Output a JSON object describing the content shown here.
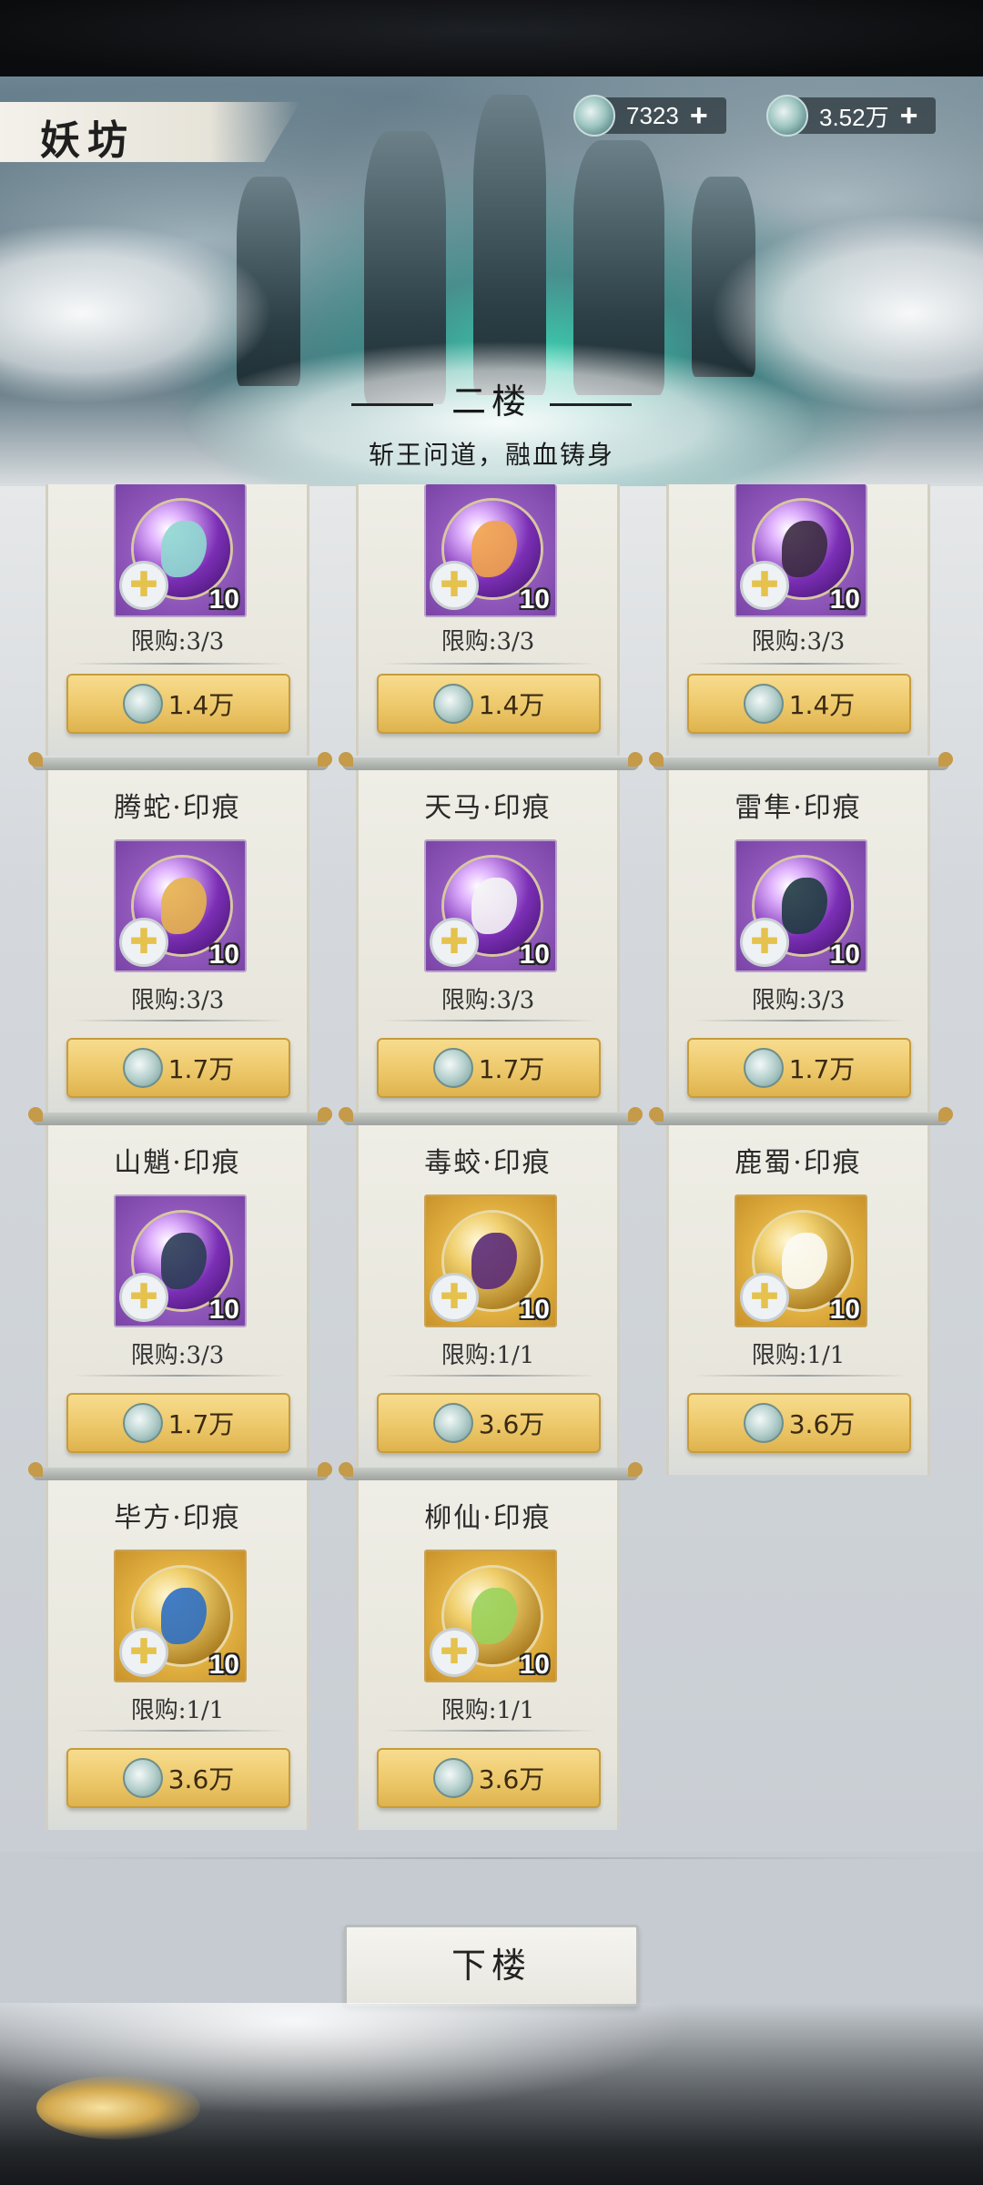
{
  "header": {
    "title": "妖坊",
    "currency1": {
      "icon": "jade-ring-icon",
      "amount": "7323"
    },
    "currency2": {
      "icon": "jade-pendant-icon",
      "amount": "3.52万"
    },
    "plus": "+"
  },
  "floor": {
    "name": "二楼",
    "subtitle": "斩王问道，融血铸身"
  },
  "items": [
    {
      "name": "",
      "tier": "purple",
      "qty": "10",
      "limit": "限购:3/3",
      "price": "1.4万",
      "color": "#8fd8d0"
    },
    {
      "name": "",
      "tier": "purple",
      "qty": "10",
      "limit": "限购:3/3",
      "price": "1.4万",
      "color": "#f1a24a"
    },
    {
      "name": "",
      "tier": "purple",
      "qty": "10",
      "limit": "限购:3/3",
      "price": "1.4万",
      "color": "#3a2a40"
    },
    {
      "name": "腾蛇·印痕",
      "tier": "purple",
      "qty": "10",
      "limit": "限购:3/3",
      "price": "1.7万",
      "color": "#e6b24d"
    },
    {
      "name": "天马·印痕",
      "tier": "purple",
      "qty": "10",
      "limit": "限购:3/3",
      "price": "1.7万",
      "color": "#f4f4f4"
    },
    {
      "name": "雷隼·印痕",
      "tier": "purple",
      "qty": "10",
      "limit": "限购:3/3",
      "price": "1.7万",
      "color": "#1f3b40"
    },
    {
      "name": "山魈·印痕",
      "tier": "purple",
      "qty": "10",
      "limit": "限购:3/3",
      "price": "1.7万",
      "color": "#2b3c55"
    },
    {
      "name": "毒蛟·印痕",
      "tier": "gold",
      "qty": "10",
      "limit": "限购:1/1",
      "price": "3.6万",
      "color": "#5a2a78"
    },
    {
      "name": "鹿蜀·印痕",
      "tier": "gold",
      "qty": "10",
      "limit": "限购:1/1",
      "price": "3.6万",
      "color": "#fbfbf6"
    },
    {
      "name": "毕方·印痕",
      "tier": "gold",
      "qty": "10",
      "limit": "限购:1/1",
      "price": "3.6万",
      "color": "#2e6fc2"
    },
    {
      "name": "柳仙·印痕",
      "tier": "gold",
      "qty": "10",
      "limit": "限购:1/1",
      "price": "3.6万",
      "color": "#9ad25c"
    }
  ],
  "footer": {
    "down_label": "下楼"
  }
}
